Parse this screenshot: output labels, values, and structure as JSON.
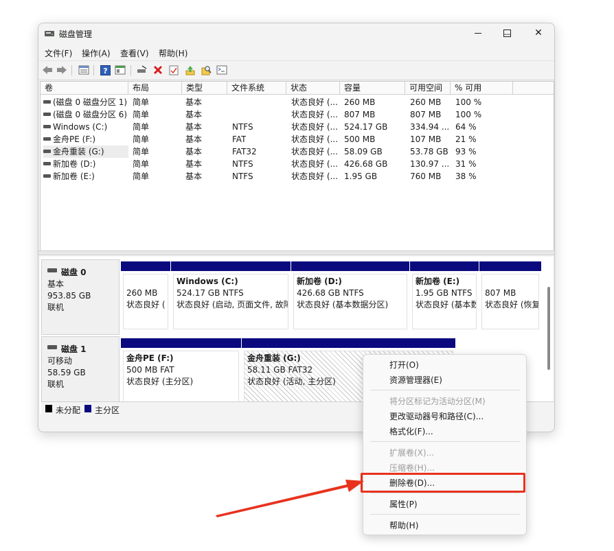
{
  "window": {
    "title": "磁盘管理",
    "controls": {
      "minimize": "—",
      "maximize": "☐",
      "close": "✕"
    }
  },
  "menu": [
    "文件(F)",
    "操作(A)",
    "查看(V)",
    "帮助(H)"
  ],
  "toolbar": {
    "icons": [
      "back-arrow-icon",
      "forward-arrow-icon",
      "volume-list-icon",
      "help-icon",
      "properties-icon",
      "connect-drive-icon",
      "delete-icon",
      "check-icon",
      "upload-icon",
      "search-icon",
      "console-icon"
    ]
  },
  "volume_list": {
    "columns": [
      "卷",
      "布局",
      "类型",
      "文件系统",
      "状态",
      "容量",
      "可用空间",
      "% 可用"
    ],
    "rows": [
      [
        "(磁盘 0 磁盘分区 1)",
        "简单",
        "基本",
        "",
        "状态良好 (...",
        "260 MB",
        "260 MB",
        "100 %"
      ],
      [
        "(磁盘 0 磁盘分区 6)",
        "简单",
        "基本",
        "",
        "状态良好 (...",
        "807 MB",
        "807 MB",
        "100 %"
      ],
      [
        "Windows (C:)",
        "简单",
        "基本",
        "NTFS",
        "状态良好 (...",
        "524.17 GB",
        "334.94 ...",
        "64 %"
      ],
      [
        "金舟PE (F:)",
        "简单",
        "基本",
        "FAT",
        "状态良好 (...",
        "500 MB",
        "107 MB",
        "21 %"
      ],
      [
        "金舟重装 (G:)",
        "简单",
        "基本",
        "FAT32",
        "状态良好 (...",
        "58.09 GB",
        "53.78 GB",
        "93 %"
      ],
      [
        "新加卷 (D:)",
        "简单",
        "基本",
        "NTFS",
        "状态良好 (...",
        "426.68 GB",
        "130.97 ...",
        "31 %"
      ],
      [
        "新加卷 (E:)",
        "简单",
        "基本",
        "NTFS",
        "状态良好 (...",
        "1.95 GB",
        "760 MB",
        "38 %"
      ]
    ]
  },
  "disks": [
    {
      "name": "磁盘 0",
      "type": "基本",
      "size": "953.85 GB",
      "status": "联机",
      "partitions": [
        {
          "name": "",
          "size": "260 MB",
          "status": "状态良好 ("
        },
        {
          "name": "Windows  (C:)",
          "size": "524.17 GB NTFS",
          "status": "状态良好 (启动, 页面文件, 故障"
        },
        {
          "name": "新加卷  (D:)",
          "size": "426.68 GB NTFS",
          "status": "状态良好 (基本数据分区)"
        },
        {
          "name": "新加卷  (E:)",
          "size": "1.95 GB NTFS",
          "status": "状态良好 (基本数"
        },
        {
          "name": "",
          "size": "807 MB",
          "status": "状态良好 (恢复"
        }
      ]
    },
    {
      "name": "磁盘 1",
      "type": "可移动",
      "size": "58.59 GB",
      "status": "联机",
      "partitions": [
        {
          "name": "金舟PE  (F:)",
          "size": "500 MB FAT",
          "status": "状态良好 (主分区)"
        },
        {
          "name": "金舟重装  (G:)",
          "size": "58.11 GB FAT32",
          "status": "状态良好 (活动, 主分区)"
        }
      ]
    }
  ],
  "legend": [
    {
      "label": "未分配",
      "color": "#000000"
    },
    {
      "label": "主分区",
      "color": "#0a0a7e"
    }
  ],
  "context_menu": {
    "items": [
      {
        "label": "打开(O)",
        "disabled": false
      },
      {
        "label": "资源管理器(E)",
        "disabled": false
      },
      {
        "label": "将分区标记为活动分区(M)",
        "disabled": true
      },
      {
        "label": "更改驱动器号和路径(C)...",
        "disabled": false
      },
      {
        "label": "格式化(F)...",
        "disabled": false
      },
      {
        "label": "扩展卷(X)...",
        "disabled": true
      },
      {
        "label": "压缩卷(H)...",
        "disabled": true
      },
      {
        "label": "删除卷(D)...",
        "disabled": false
      },
      {
        "label": "属性(P)",
        "disabled": false
      },
      {
        "label": "帮助(H)",
        "disabled": false
      }
    ]
  },
  "colors": {
    "annotation": "#e8321e",
    "partition_bar": "#0a0a7e"
  }
}
